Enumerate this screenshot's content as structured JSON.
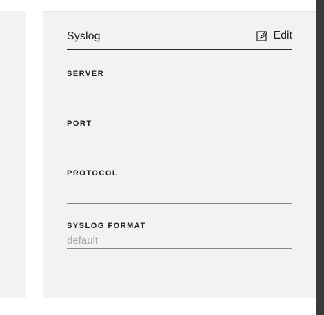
{
  "panel": {
    "title": "Syslog",
    "edit_label": "Edit"
  },
  "fields": [
    {
      "label": "SERVER",
      "value": ""
    },
    {
      "label": "PORT",
      "value": ""
    },
    {
      "label": "PROTOCOL",
      "value": ""
    },
    {
      "label": "SYSLOG FORMAT",
      "value": "default"
    }
  ],
  "icons": {
    "edit": "edit-icon"
  },
  "colors": {
    "card_background": "#f2f2f2",
    "placeholder_text": "#a8a8a8",
    "right_edge": "#404040"
  }
}
